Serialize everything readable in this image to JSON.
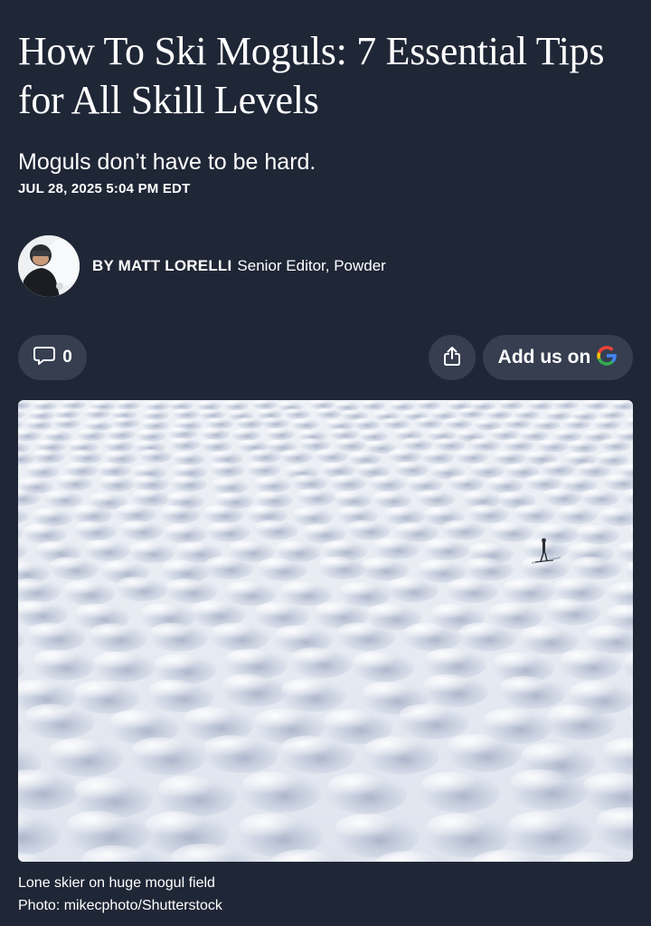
{
  "article": {
    "title": "How To Ski Moguls: 7 Essential Tips for All Skill Levels",
    "subtitle": "Moguls don’t have to be hard.",
    "date": "JUL 28, 2025 5:04 PM EDT"
  },
  "author": {
    "name": "BY MATT LORELLI",
    "role": "Senior Editor, Powder"
  },
  "actions": {
    "comments_count": "0",
    "add_us_label": "Add us on"
  },
  "icons": {
    "comment": "comment-icon",
    "share": "share-icon",
    "brand": "google-icon"
  },
  "image": {
    "caption": "Lone skier on huge mogul field",
    "credit": "Photo: mikecphoto/Shutterstock"
  },
  "colors": {
    "background": "#1f2636",
    "pill": "#363e50",
    "text": "#ffffff"
  }
}
